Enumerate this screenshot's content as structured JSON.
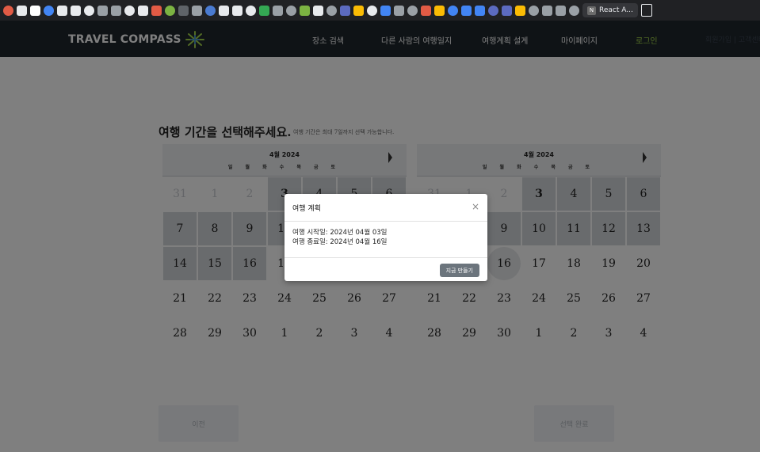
{
  "browser": {
    "bookmark_tab_label": "React A...",
    "bookmark_colors": [
      "#e25b45",
      "#e8eaed",
      "#ffffff",
      "#4285f4",
      "#e8eaed",
      "#e8eaed",
      "#e8eaed",
      "#9aa0a6",
      "#9aa0a6",
      "#e8eaed",
      "#e8eaed",
      "#e25b45",
      "#7cb342",
      "#5f6368",
      "#9aa0a6",
      "#4a7bd1",
      "#e8eaed",
      "#e8eaed",
      "#e8eaed",
      "#34a853",
      "#9aa0a6",
      "#9aa0a6",
      "#7cb342",
      "#e8eaed",
      "#9aa0a6",
      "#5c6bc0",
      "#fbbc04",
      "#e8eaed",
      "#4285f4",
      "#9aa0a6",
      "#9aa0a6",
      "#e25b45",
      "#fbbc04",
      "#4285f4",
      "#4285f4",
      "#4285f4",
      "#5c6bc0",
      "#5c6bc0",
      "#fbbc04",
      "#9aa0a6",
      "#9aa0a6",
      "#9aa0a6",
      "#9aa0a6"
    ]
  },
  "site": {
    "logo_text": "TRAVEL COMPASS",
    "nav": {
      "search": "장소 검색",
      "others_journal": "다른 사람의 여행일지",
      "plan_design": "여행계획 설계",
      "mypage": "마이페이지",
      "login": "로그인"
    },
    "faded_nav": "회원가입 | 고객센터"
  },
  "page": {
    "title": "여행 기간을 선택해주세요.",
    "subtitle": "여행 기간은 최대 7일까지 선택 가능합니다.",
    "prev_button": "이전",
    "done_button": "선택 완료"
  },
  "calendars": [
    {
      "month_label": "4월 2024",
      "weekdays": "일 월 화 수 목 금 토",
      "days": [
        {
          "d": "31",
          "s": "muted"
        },
        {
          "d": "1",
          "s": "muted"
        },
        {
          "d": "2",
          "s": "muted"
        },
        {
          "d": "3",
          "s": "start"
        },
        {
          "d": "4",
          "s": "range"
        },
        {
          "d": "5",
          "s": "range"
        },
        {
          "d": "6",
          "s": "range"
        },
        {
          "d": "7",
          "s": "range"
        },
        {
          "d": "8",
          "s": "range"
        },
        {
          "d": "9",
          "s": "range"
        },
        {
          "d": "10",
          "s": "range"
        },
        {
          "d": "11",
          "s": "range"
        },
        {
          "d": "12",
          "s": "range"
        },
        {
          "d": "13",
          "s": "range"
        },
        {
          "d": "14",
          "s": "range"
        },
        {
          "d": "15",
          "s": "range"
        },
        {
          "d": "16",
          "s": "range"
        },
        {
          "d": "17",
          "s": ""
        },
        {
          "d": "18",
          "s": ""
        },
        {
          "d": "19",
          "s": ""
        },
        {
          "d": "20",
          "s": ""
        },
        {
          "d": "21",
          "s": ""
        },
        {
          "d": "22",
          "s": ""
        },
        {
          "d": "23",
          "s": ""
        },
        {
          "d": "24",
          "s": ""
        },
        {
          "d": "25",
          "s": ""
        },
        {
          "d": "26",
          "s": ""
        },
        {
          "d": "27",
          "s": ""
        },
        {
          "d": "28",
          "s": ""
        },
        {
          "d": "29",
          "s": ""
        },
        {
          "d": "30",
          "s": ""
        },
        {
          "d": "1",
          "s": ""
        },
        {
          "d": "2",
          "s": ""
        },
        {
          "d": "3",
          "s": ""
        },
        {
          "d": "4",
          "s": ""
        }
      ]
    },
    {
      "month_label": "4월 2024",
      "weekdays": "일 월 화 수 목 금 토",
      "days": [
        {
          "d": "31",
          "s": "muted"
        },
        {
          "d": "1",
          "s": "muted"
        },
        {
          "d": "2",
          "s": "muted"
        },
        {
          "d": "3",
          "s": "start"
        },
        {
          "d": "4",
          "s": "range"
        },
        {
          "d": "5",
          "s": "range"
        },
        {
          "d": "6",
          "s": "range"
        },
        {
          "d": "7",
          "s": "range"
        },
        {
          "d": "8",
          "s": "range"
        },
        {
          "d": "9",
          "s": "range"
        },
        {
          "d": "10",
          "s": "range"
        },
        {
          "d": "11",
          "s": "range"
        },
        {
          "d": "12",
          "s": "range"
        },
        {
          "d": "13",
          "s": "range"
        },
        {
          "d": "14",
          "s": "range"
        },
        {
          "d": "15",
          "s": "range"
        },
        {
          "d": "16",
          "s": "end"
        },
        {
          "d": "17",
          "s": ""
        },
        {
          "d": "18",
          "s": ""
        },
        {
          "d": "19",
          "s": ""
        },
        {
          "d": "20",
          "s": ""
        },
        {
          "d": "21",
          "s": ""
        },
        {
          "d": "22",
          "s": ""
        },
        {
          "d": "23",
          "s": ""
        },
        {
          "d": "24",
          "s": ""
        },
        {
          "d": "25",
          "s": ""
        },
        {
          "d": "26",
          "s": ""
        },
        {
          "d": "27",
          "s": ""
        },
        {
          "d": "28",
          "s": ""
        },
        {
          "d": "29",
          "s": ""
        },
        {
          "d": "30",
          "s": ""
        },
        {
          "d": "1",
          "s": ""
        },
        {
          "d": "2",
          "s": ""
        },
        {
          "d": "3",
          "s": ""
        },
        {
          "d": "4",
          "s": ""
        }
      ]
    }
  ],
  "modal": {
    "title": "여행 계획",
    "close_glyph": "×",
    "start_line": "여행 시작일: 2024년 04월 03일",
    "end_line": "여행 종료일: 2024년 04월 16일",
    "create_button": "지금 만들기"
  },
  "colors": {
    "header_bg": "#1f262d",
    "login_accent": "#a4d64a",
    "logo_icon": "#a4d64a",
    "modal_button": "#6c757d"
  }
}
